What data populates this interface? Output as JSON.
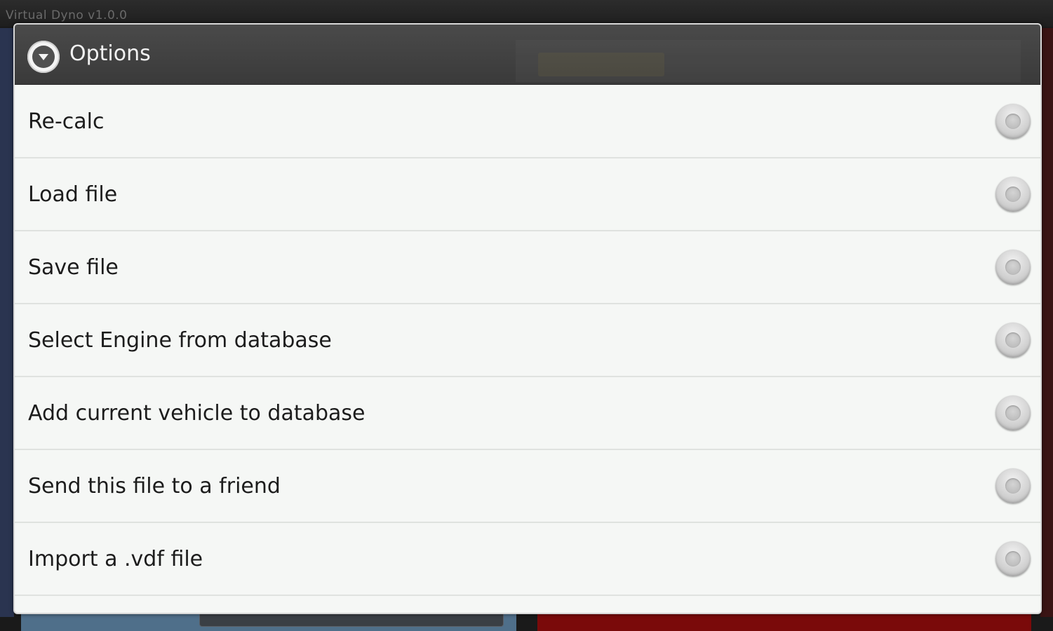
{
  "app": {
    "title": "Virtual Dyno v1.0.0"
  },
  "dialog": {
    "title": "Options",
    "icon": "dropdown-circle-icon",
    "options": [
      {
        "label": "Re-calc",
        "selected": false
      },
      {
        "label": "Load file",
        "selected": false
      },
      {
        "label": "Save file",
        "selected": false
      },
      {
        "label": "Select Engine from database",
        "selected": false
      },
      {
        "label": "Add current vehicle to database",
        "selected": false
      },
      {
        "label": "Send this file to a friend",
        "selected": false
      },
      {
        "label": "Import a .vdf file",
        "selected": false
      }
    ]
  },
  "colors": {
    "header_bg": "#404040",
    "list_bg": "#f5f7f5",
    "divider": "#dfe2df",
    "text": "#1c1c1c",
    "bg_left_panel": "#4f6f8a",
    "bg_right_panel": "#7a0a0a"
  }
}
